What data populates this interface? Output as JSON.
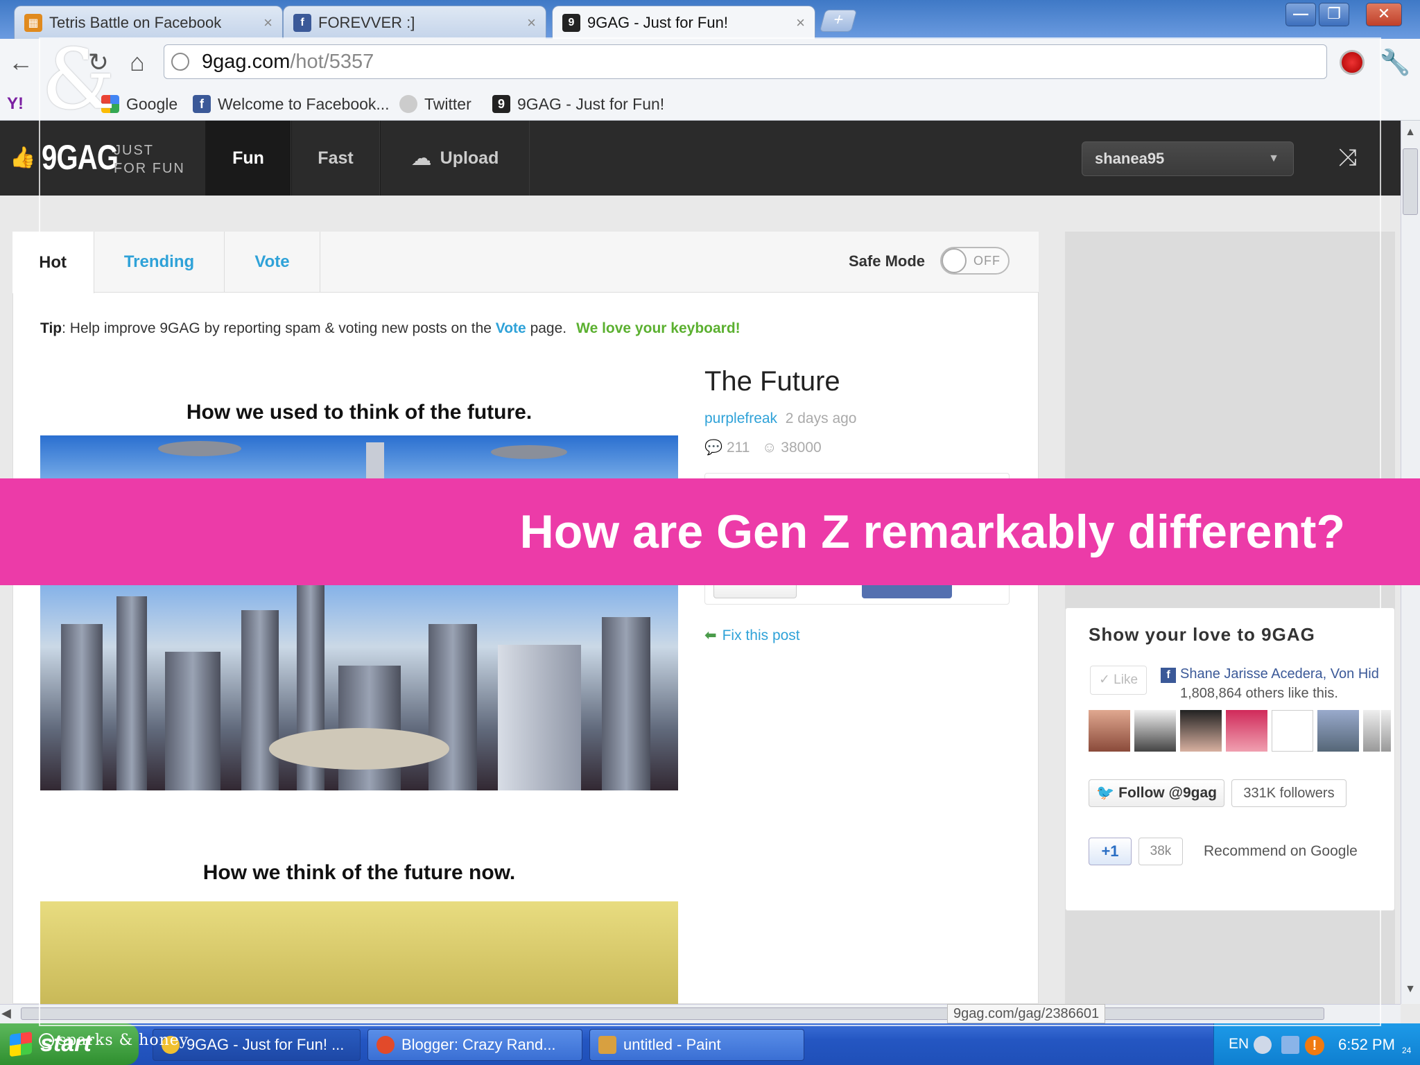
{
  "browser": {
    "tabs": [
      {
        "label": "Tetris Battle on Facebook",
        "favicon_color": "#e08a1e"
      },
      {
        "label": "FOREVVER :]",
        "favicon_color": "#3b5998"
      },
      {
        "label": "9GAG - Just for Fun!",
        "favicon_color": "#222222"
      }
    ],
    "new_tab_symbol": "+",
    "window_controls": {
      "minimize": "—",
      "restore": "❐",
      "close": "✕"
    },
    "url": {
      "domain": "9gag.com",
      "path": "/hot/5357"
    },
    "bookmarks": [
      {
        "label": "Y!",
        "icon": "yahoo-icon"
      },
      {
        "label": "Google",
        "icon": "google-icon"
      },
      {
        "label": "Welcome to Facebook...",
        "icon": "facebook-icon"
      },
      {
        "label": "Twitter",
        "icon": "globe-icon"
      },
      {
        "label": "9GAG - Just for Fun!",
        "icon": "9gag-icon"
      }
    ],
    "status_url": "9gag.com/gag/2386601"
  },
  "site": {
    "logo": "9GAG",
    "tagline_1": "JUST",
    "tagline_2": "FOR FUN",
    "nav": [
      "Fun",
      "Fast",
      "Upload"
    ],
    "username": "shanea95",
    "content_tabs": [
      "Hot",
      "Trending",
      "Vote"
    ],
    "safe_mode_label": "Safe Mode",
    "safe_mode_state": "OFF",
    "tip": {
      "prefix": "Tip",
      "text": ": Help improve 9GAG by reporting spam & voting new posts on the ",
      "vote_word": "Vote",
      "suffix": " page.",
      "green": "We love your keyboard!"
    },
    "post": {
      "caption_top": "How we used to think of the future.",
      "caption_bottom": "How we think of the future now.",
      "title": "The Future",
      "author": "purplefreak",
      "age": "2 days ago",
      "comments": "211",
      "points": "38000",
      "fix_link": "Fix this post"
    },
    "sidebar": {
      "love_title": "Show your love to 9GAG",
      "like_button": "✓ Like",
      "like_names": "Shane Jarisse Acedera, Von Hid",
      "like_count_text": "1,808,864 others like this.",
      "follow_button": "Follow @9gag",
      "followers": "331K followers",
      "plusone": "+1",
      "plusone_count": "38k",
      "recommend": "Recommend on Google"
    }
  },
  "taskbar": {
    "start": "start",
    "items": [
      {
        "label": "9GAG - Just for Fun! ...",
        "icon_color": "#f0c030"
      },
      {
        "label": "Blogger: Crazy Rand...",
        "icon_color": "#e24a2a"
      },
      {
        "label": "untitled - Paint",
        "icon_color": "#d8a040"
      }
    ],
    "lang": "EN",
    "clock": "6:52 PM"
  },
  "slide": {
    "headline": "How are Gen Z remarkably different?",
    "logo_mark": "&",
    "brand": "sparks & honey",
    "page_number": "24",
    "banner_color": "#ec3ba8"
  }
}
